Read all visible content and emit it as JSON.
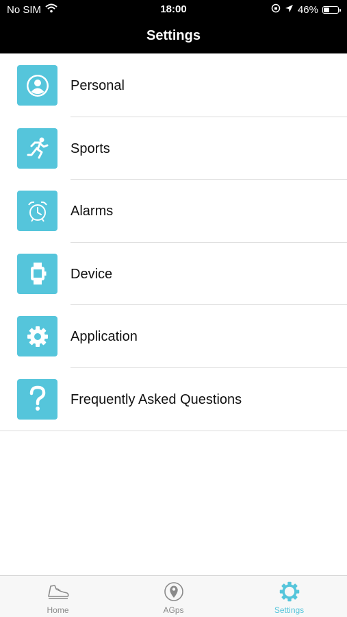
{
  "status_bar": {
    "carrier": "No SIM",
    "time": "18:00",
    "battery_percent_label": "46%",
    "battery_level": 0.46,
    "icons": [
      "wifi-icon",
      "orientation-lock-icon",
      "location-arrow-icon",
      "battery-icon"
    ]
  },
  "nav": {
    "title": "Settings"
  },
  "accent_color": "#55c5db",
  "menu": {
    "items": [
      {
        "label": "Personal",
        "icon": "person-icon"
      },
      {
        "label": "Sports",
        "icon": "runner-icon"
      },
      {
        "label": "Alarms",
        "icon": "alarm-clock-icon"
      },
      {
        "label": "Device",
        "icon": "watch-icon"
      },
      {
        "label": "Application",
        "icon": "gear-icon"
      },
      {
        "label": "Frequently Asked Questions",
        "icon": "question-mark-icon"
      }
    ]
  },
  "tabbar": {
    "tabs": [
      {
        "label": "Home",
        "icon": "shoe-icon",
        "active": false
      },
      {
        "label": "AGps",
        "icon": "location-pin-icon",
        "active": false
      },
      {
        "label": "Settings",
        "icon": "gear-icon",
        "active": true
      }
    ]
  }
}
